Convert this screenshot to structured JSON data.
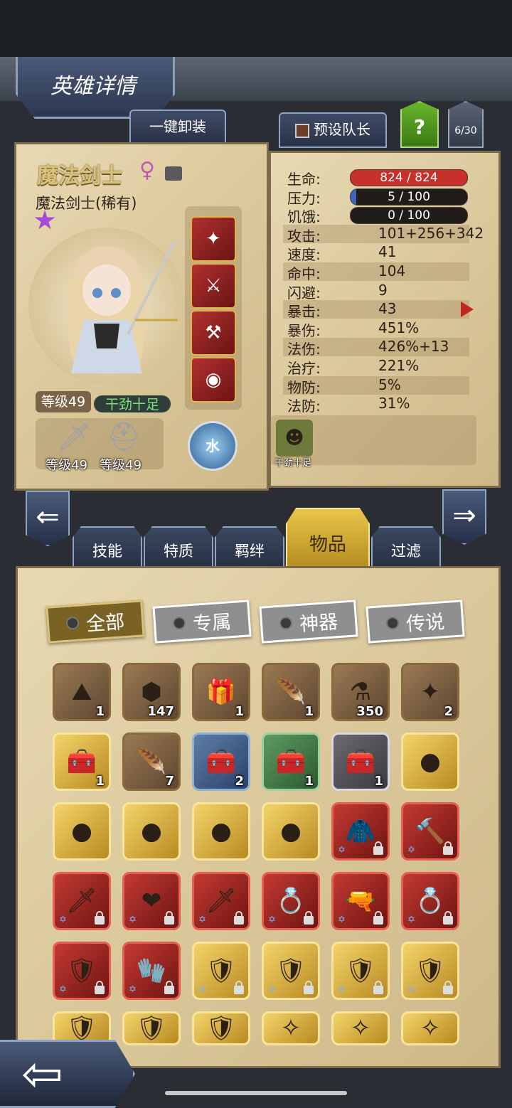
{
  "header": {
    "title": "英雄详情"
  },
  "top_buttons": {
    "unequip_all": "一键卸装",
    "preset_captain": "预设队长",
    "help": "?",
    "count": "6/30"
  },
  "hero": {
    "name": "魔法剑士",
    "gender_symbol": "♀",
    "class_label": "魔法剑士(稀有)",
    "level": "等级49",
    "trait": "干劲十足",
    "weapon_level": "等级49",
    "armor_level": "等级49",
    "element": "水"
  },
  "stats": [
    {
      "key": "生命:",
      "value": "824 / 824",
      "bar": true,
      "fill": 1.0,
      "color": "#c8302c"
    },
    {
      "key": "压力:",
      "value": "5 / 100",
      "bar": true,
      "fill": 0.05,
      "color": "#3f63c0"
    },
    {
      "key": "饥饿:",
      "value": "0 / 100",
      "bar": true,
      "fill": 0.0,
      "color": "#c88a20"
    },
    {
      "key": "攻击:",
      "value": "101+256+342"
    },
    {
      "key": "速度:",
      "value": "41"
    },
    {
      "key": "命中:",
      "value": "104"
    },
    {
      "key": "闪避:",
      "value": "9"
    },
    {
      "key": "暴击:",
      "value": "43"
    },
    {
      "key": "暴伤:",
      "value": "451%"
    },
    {
      "key": "法伤:",
      "value": "426%+13"
    },
    {
      "key": "治疗:",
      "value": "221%"
    },
    {
      "key": "物防:",
      "value": "5%"
    },
    {
      "key": "法防:",
      "value": "31%"
    }
  ],
  "trait_icon_caption": "干劲十足",
  "tabs": [
    "技能",
    "特质",
    "羁绊",
    "物品",
    "过滤"
  ],
  "filters": [
    "全部",
    "专属",
    "神器",
    "传说"
  ],
  "items": [
    {
      "icon": "⛰",
      "count": "1",
      "frame": "brown"
    },
    {
      "icon": "⬢",
      "count": "147",
      "frame": "brown"
    },
    {
      "icon": "🎁",
      "count": "1",
      "frame": "brown"
    },
    {
      "icon": "🪶",
      "count": "1",
      "frame": "brown"
    },
    {
      "icon": "⚗",
      "count": "350",
      "frame": "brown"
    },
    {
      "icon": "✦",
      "count": "2",
      "frame": "brown"
    },
    {
      "icon": "🧰",
      "count": "1",
      "frame": "gold"
    },
    {
      "icon": "🪶",
      "count": "7",
      "frame": "brown"
    },
    {
      "icon": "🧰",
      "count": "2",
      "frame": "blue"
    },
    {
      "icon": "🧰",
      "count": "1",
      "frame": "green"
    },
    {
      "icon": "🧰",
      "count": "1",
      "frame": "silver"
    },
    {
      "icon": "●",
      "count": "",
      "frame": "gold"
    },
    {
      "icon": "●",
      "count": "",
      "frame": "gold"
    },
    {
      "icon": "●",
      "count": "",
      "frame": "gold"
    },
    {
      "icon": "●",
      "count": "",
      "frame": "gold"
    },
    {
      "icon": "●",
      "count": "",
      "frame": "gold"
    },
    {
      "icon": "🧥",
      "count": "",
      "frame": "red",
      "locked": true
    },
    {
      "icon": "🔨",
      "count": "",
      "frame": "red",
      "locked": true
    },
    {
      "icon": "🗡",
      "count": "",
      "frame": "red",
      "locked": true
    },
    {
      "icon": "❤",
      "count": "",
      "frame": "red",
      "locked": true
    },
    {
      "icon": "🗡",
      "count": "",
      "frame": "red",
      "locked": true
    },
    {
      "icon": "💍",
      "count": "",
      "frame": "red",
      "locked": true
    },
    {
      "icon": "🔫",
      "count": "",
      "frame": "red",
      "locked": true
    },
    {
      "icon": "💍",
      "count": "",
      "frame": "red",
      "locked": true
    },
    {
      "icon": "🛡",
      "count": "",
      "frame": "red",
      "locked": true
    },
    {
      "icon": "🧤",
      "count": "",
      "frame": "red",
      "locked": true
    },
    {
      "icon": "🛡",
      "count": "",
      "frame": "gold",
      "locked": true
    },
    {
      "icon": "🛡",
      "count": "",
      "frame": "gold",
      "locked": true
    },
    {
      "icon": "🛡",
      "count": "",
      "frame": "gold",
      "locked": true
    },
    {
      "icon": "🛡",
      "count": "",
      "frame": "gold",
      "locked": true
    },
    {
      "icon": "🛡",
      "count": "",
      "frame": "gold"
    },
    {
      "icon": "🛡",
      "count": "",
      "frame": "gold"
    },
    {
      "icon": "🛡",
      "count": "",
      "frame": "gold"
    },
    {
      "icon": "✧",
      "count": "",
      "frame": "gold"
    },
    {
      "icon": "✧",
      "count": "",
      "frame": "gold"
    },
    {
      "icon": "✧",
      "count": "",
      "frame": "gold"
    }
  ]
}
